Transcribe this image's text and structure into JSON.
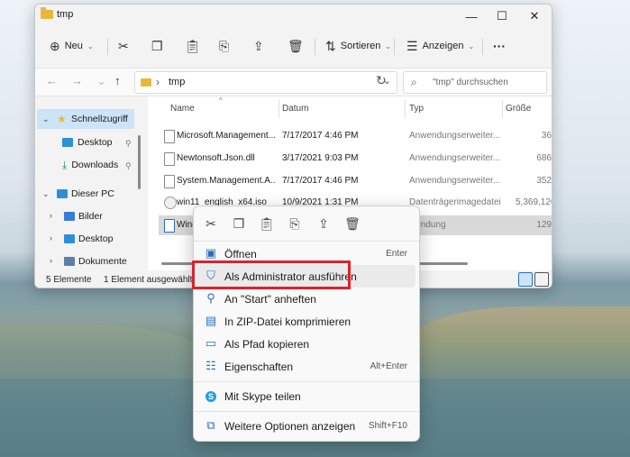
{
  "window": {
    "title": "tmp",
    "minimize": "—",
    "maximize": "☐",
    "close": "✕"
  },
  "toolbar": {
    "new_label": "Neu",
    "sort_label": "Sortieren",
    "view_label": "Anzeigen",
    "more": "···"
  },
  "address": {
    "path": "tmp",
    "search_placeholder": "\"tmp\" durchsuchen"
  },
  "nav": {
    "quick_access": "Schnellzugriff",
    "desktop": "Desktop",
    "downloads": "Downloads",
    "this_pc": "Dieser PC",
    "pictures": "Bilder",
    "desktop2": "Desktop",
    "documents": "Dokumente"
  },
  "columns": {
    "name": "Name",
    "date": "Datum",
    "type": "Typ",
    "size": "Größe"
  },
  "files": [
    {
      "name": "Microsoft.Management....",
      "date": "7/17/2017 4:46 PM",
      "type": "Anwendungserweiter...",
      "size": "36"
    },
    {
      "name": "Newtonsoft.Json.dll",
      "date": "3/17/2021 9:03 PM",
      "type": "Anwendungserweiter...",
      "size": "686"
    },
    {
      "name": "System.Management.A...",
      "date": "7/17/2017 4:46 PM",
      "type": "Anwendungserweiter...",
      "size": "352"
    },
    {
      "name": "win11_english_x64.iso",
      "date": "10/9/2021 1:31 PM",
      "type": "Datenträgerimagedatei",
      "size": "5,369,126"
    },
    {
      "name": "Windo",
      "date": "",
      "type": "wendung",
      "size": "129"
    }
  ],
  "status": {
    "count": "5 Elemente",
    "selected": "1 Element ausgewählt (1"
  },
  "context_menu": {
    "items": [
      {
        "label": "Öffnen",
        "shortcut": "Enter"
      },
      {
        "label": "Als Administrator ausführen",
        "shortcut": ""
      },
      {
        "label": "An \"Start\" anheften",
        "shortcut": ""
      },
      {
        "label": "In ZIP-Datei komprimieren",
        "shortcut": ""
      },
      {
        "label": "Als Pfad kopieren",
        "shortcut": ""
      },
      {
        "label": "Eigenschaften",
        "shortcut": "Alt+Enter"
      },
      {
        "label": "Mit Skype teilen",
        "shortcut": ""
      },
      {
        "label": "Weitere Optionen anzeigen",
        "shortcut": "Shift+F10"
      }
    ]
  },
  "colors": {
    "highlight": "#e0202a",
    "selection": "#cce4f7",
    "folder": "#e8b83a"
  }
}
